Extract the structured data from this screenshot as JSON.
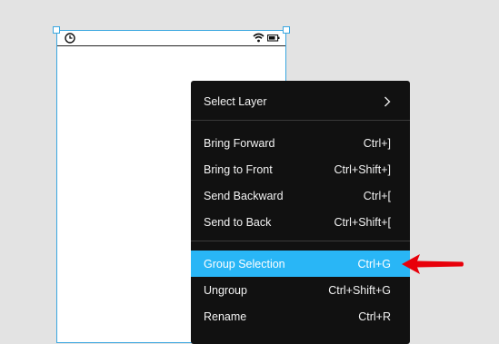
{
  "menu": {
    "select_layer": "Select Layer",
    "groups": [
      [
        {
          "label": "Bring Forward",
          "shortcut": "Ctrl+]"
        },
        {
          "label": "Bring to Front",
          "shortcut": "Ctrl+Shift+]"
        },
        {
          "label": "Send Backward",
          "shortcut": "Ctrl+["
        },
        {
          "label": "Send to Back",
          "shortcut": "Ctrl+Shift+["
        }
      ],
      [
        {
          "label": "Group Selection",
          "shortcut": "Ctrl+G"
        },
        {
          "label": "Ungroup",
          "shortcut": "Ctrl+Shift+G"
        },
        {
          "label": "Rename",
          "shortcut": "Ctrl+R"
        }
      ]
    ]
  },
  "status_bar": {
    "left_icon": "clock-icon",
    "right_icons": [
      "wifi-icon",
      "battery-icon"
    ]
  },
  "colors": {
    "highlight": "#29b6f6",
    "menu_bg": "#111111",
    "annotation_arrow": "#e8000a",
    "selection_border": "#3aa7e0"
  }
}
